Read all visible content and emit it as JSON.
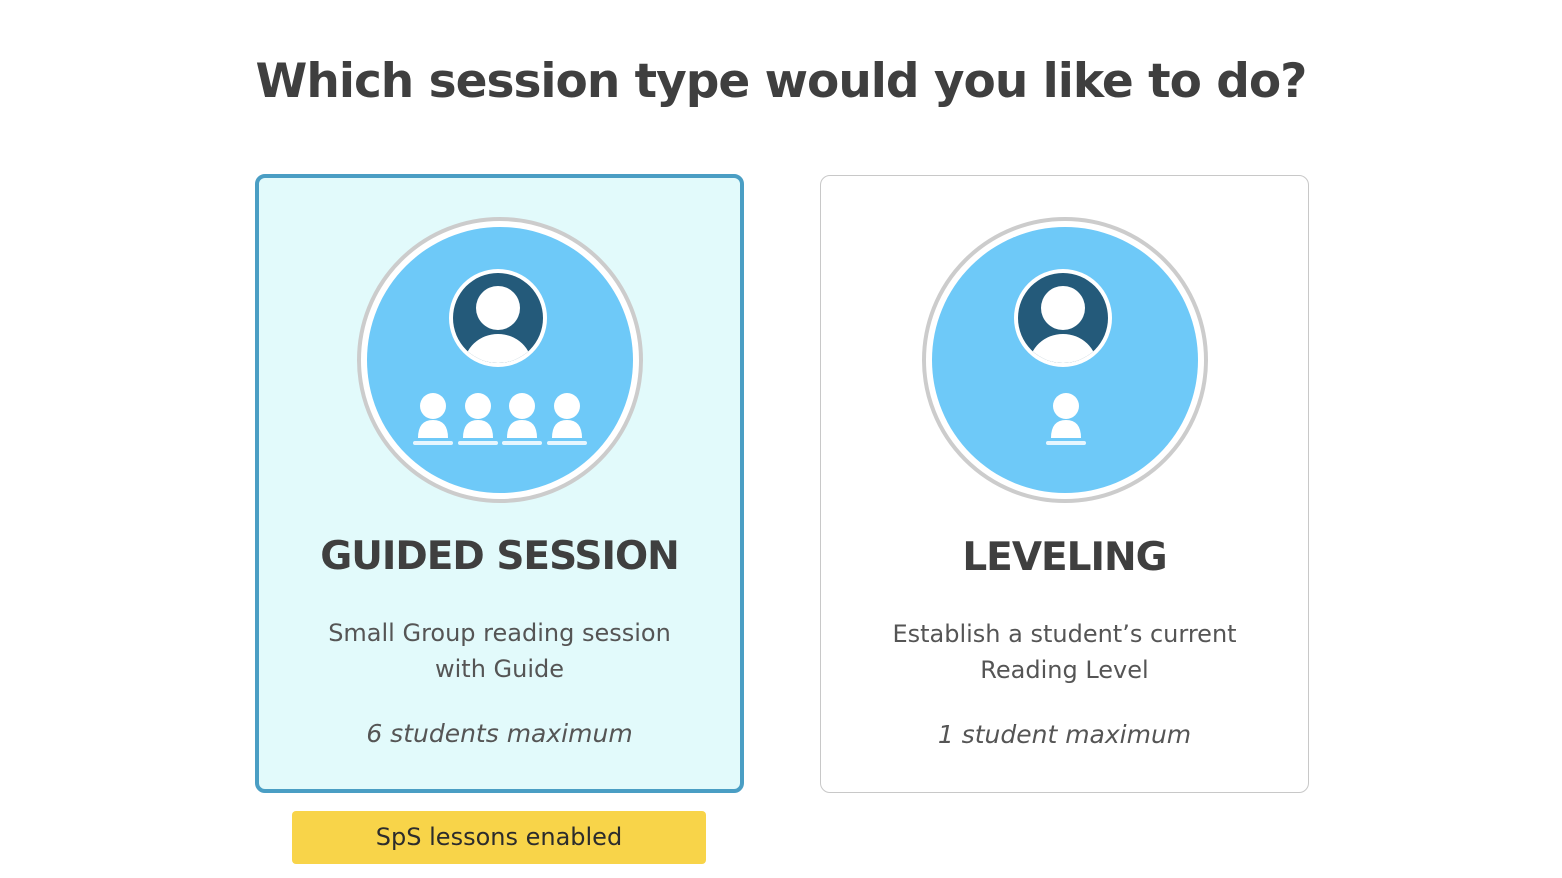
{
  "heading": "Which session type would you like to do?",
  "colors": {
    "selected_border": "#4a9ec4",
    "selected_background": "#e2fafb",
    "icon_circle": "#6ec9f8",
    "icon_dark": "#245a7a",
    "badge_background": "#f8d449"
  },
  "cards": [
    {
      "id": "guided",
      "selected": true,
      "icon": "teacher-with-group-icon",
      "title": "GUIDED SESSION",
      "description": "Small Group reading session with Guide",
      "max": "6 students maximum"
    },
    {
      "id": "leveling",
      "selected": false,
      "icon": "teacher-with-student-icon",
      "title": "LEVELING",
      "description": "Establish a student’s current Reading Level",
      "max": "1 student maximum"
    }
  ],
  "badge": {
    "label": "SpS lessons enabled"
  }
}
